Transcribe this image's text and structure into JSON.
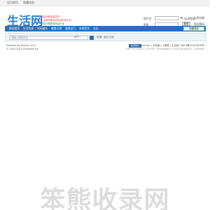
{
  "topbar": {
    "links": [
      "设为首页",
      "收藏本站"
    ]
  },
  "logo": {
    "text": "生活网"
  },
  "slogan": {
    "lines": [
      "免费分类信息发布",
      "生活资讯服务尽在我们本平台",
      "提供分类服务网站大全"
    ]
  },
  "login": {
    "username_label": "用户名",
    "password_label": "密码",
    "remember_label": "自动登录",
    "login_button": "登录",
    "register_link": "立即注册",
    "forgot_link": "找回密码"
  },
  "nav": {
    "items": [
      "网站首页",
      "生活信息",
      "休闲娱乐",
      "美食天地",
      "旅游出行",
      "本地资讯",
      "论坛"
    ],
    "quick_nav": "快捷导航"
  },
  "search": {
    "placeholder": "请输入搜索内容",
    "scope": "帖子",
    "hot_label": "热搜:",
    "hot_items": [
      "活动",
      "交友"
    ]
  },
  "footer": {
    "powered_by": "Powered by Discuz! X3.2",
    "copyright": "© 2001-2013 Comsenz Inc.",
    "badge": "站长统计",
    "links": "Archiver | 手机版 | 小黑屋 | 生活网 ( 京ICP备12345678号 )",
    "gmt": "GMT+8, 2024-1-1 00:00 , Processed in 0.034 second(s), 2 queries ."
  },
  "watermark": {
    "text": "笨熊收录网"
  },
  "colors": {
    "nav": "#2e6db4",
    "slogan_red": "#e0343a",
    "slogan_green": "#2a8a3a"
  }
}
